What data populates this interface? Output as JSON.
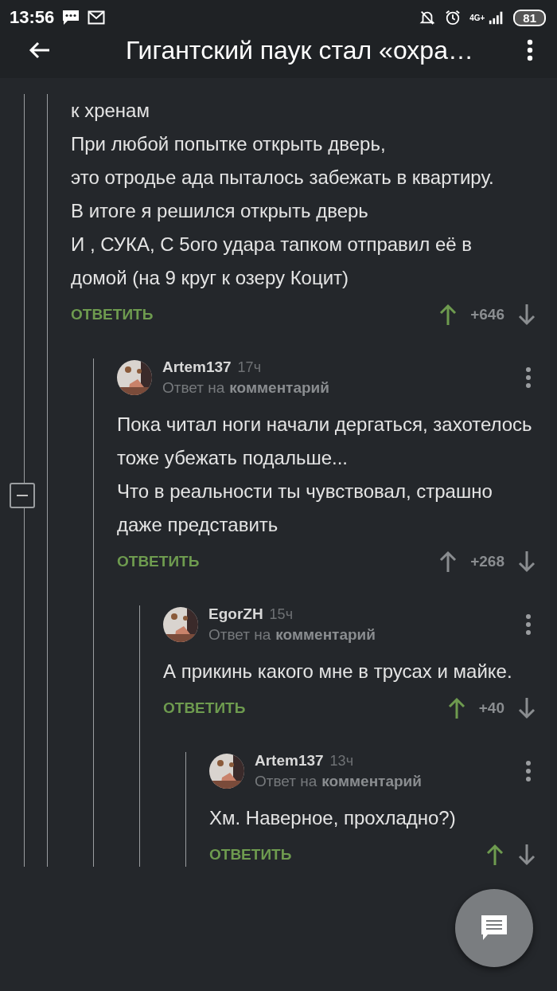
{
  "status_bar": {
    "time": "13:56",
    "network": "4G+",
    "battery": "81"
  },
  "toolbar": {
    "title": "Гигантский паук стал «охра…"
  },
  "comments": [
    {
      "text": "к хренам\nПри любой попытке открыть дверь,\nэто отродье ада пыталось забежать в квартиру.\nВ итоге я решился открыть дверь\nИ , СУКА, С 5ого удара тапком отправил её в домой (на 9 круг к озеру Коцит)",
      "reply": "ОТВЕТИТЬ",
      "rating": "+646",
      "upvoted": true,
      "children": [
        {
          "author": "Artem137",
          "time": "17ч",
          "reply_to_prefix": "Ответ на",
          "reply_to_link": "комментарий",
          "text": "Пока читал ноги начали дергаться, захотелось тоже убежать подальше...\nЧто в реальности ты чувствовал, страшно даже представить",
          "reply": "ОТВЕТИТЬ",
          "rating": "+268",
          "upvoted": false,
          "children": [
            {
              "author": "EgorZH",
              "time": "15ч",
              "reply_to_prefix": "Ответ на",
              "reply_to_link": "комментарий",
              "text": "А прикинь какого мне в трусах и майке.",
              "reply": "ОТВЕТИТЬ",
              "rating": "+40",
              "upvoted": true,
              "children": [
                {
                  "author": "Artem137",
                  "time": "13ч",
                  "reply_to_prefix": "Ответ на",
                  "reply_to_link": "комментарий",
                  "text": "Хм. Наверное, прохладно?)",
                  "reply": "ОТВЕТИТЬ",
                  "upvoted": true
                }
              ]
            }
          ]
        }
      ]
    }
  ]
}
